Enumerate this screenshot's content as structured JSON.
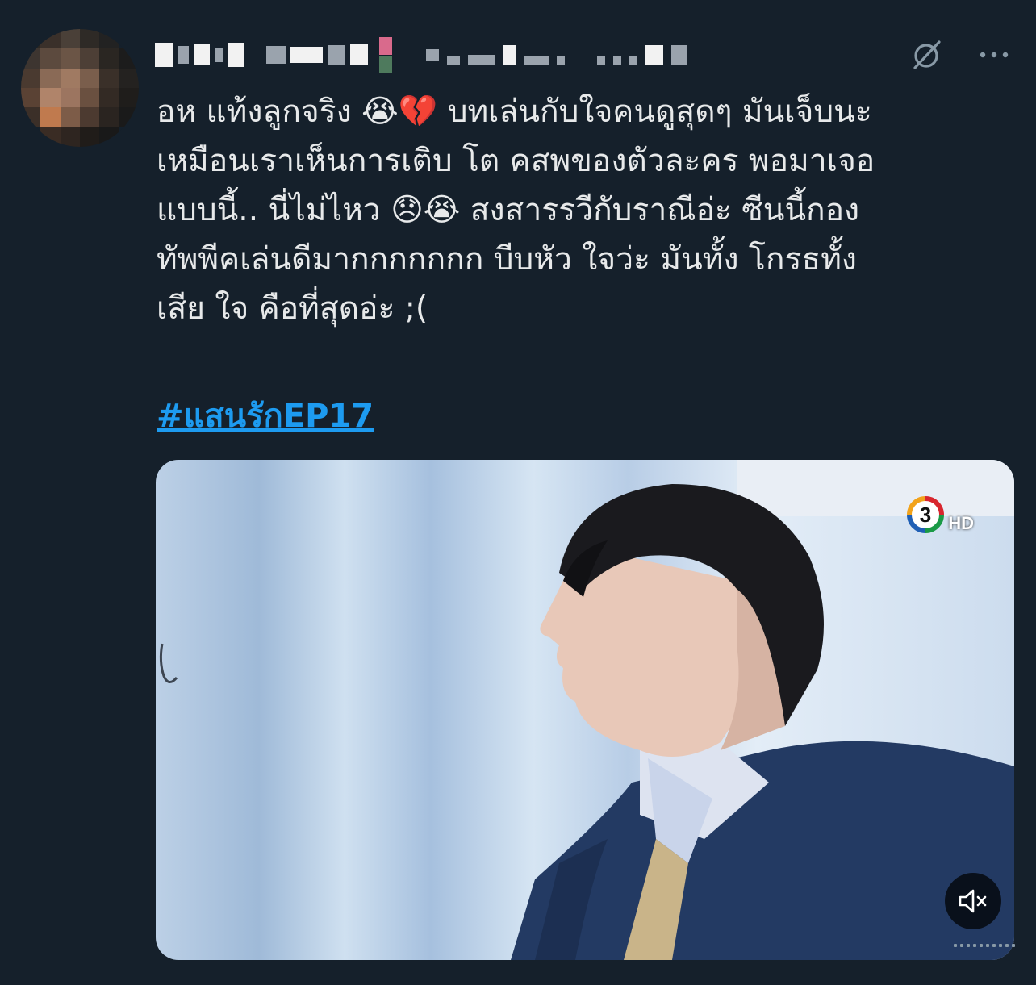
{
  "tweet": {
    "author_name": "",
    "author_handle": "",
    "text": "อห แท้งลูกจริง 😭💔 บทเล่นกับใจคนดูสุดๆ มันเจ็บนะ\nเหมือนเราเห็นการเติบ โต คสพของตัวละคร พอมาเจอ\nแบบนี้.. นี่ไม่ไหว 😞😭 สงสารรวีกับราณีอ่ะ ซีนนี้กอง\nทัพพีคเล่นดีมากกกกกกก บีบหัว ใจว่ะ มันทั้ง โกรธทั้ง\nเสีย ใจ คือที่สุดอ่ะ ;(",
    "hashtag": "#แสนรักEP17"
  },
  "media": {
    "channel_logo_text": "3",
    "channel_logo_suffix": "HD",
    "mute_icon": "speaker-muted-icon"
  },
  "icons": {
    "grok": "grok-slash-circle-icon",
    "more": "more-horizontal-icon"
  },
  "colors": {
    "background": "#15202b",
    "text": "#e7e9ea",
    "hashtag": "#1d9bf0",
    "icon": "#8899a6"
  }
}
